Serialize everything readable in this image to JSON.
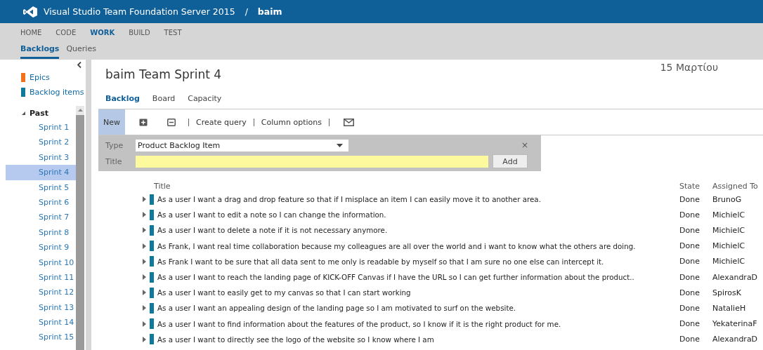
{
  "header": {
    "product": "Visual Studio Team Foundation Server 2015",
    "separator": "/",
    "project": "baim"
  },
  "nav": [
    {
      "label": "HOME",
      "selected": false
    },
    {
      "label": "CODE",
      "selected": false
    },
    {
      "label": "WORK",
      "selected": true
    },
    {
      "label": "BUILD",
      "selected": false
    },
    {
      "label": "TEST",
      "selected": false
    }
  ],
  "subnav": [
    {
      "label": "Backlogs",
      "selected": true
    },
    {
      "label": "Queries",
      "selected": false
    }
  ],
  "sidebar": {
    "levels": [
      {
        "label": "Epics",
        "color": "#f2711c"
      },
      {
        "label": "Backlog items",
        "color": "#0e7a9a"
      }
    ],
    "tree": {
      "label": "Past",
      "expanded": true,
      "children": [
        {
          "label": "Sprint 1",
          "selected": false
        },
        {
          "label": "Sprint 2",
          "selected": false
        },
        {
          "label": "Sprint 3",
          "selected": false
        },
        {
          "label": "Sprint 4",
          "selected": true
        },
        {
          "label": "Sprint 5",
          "selected": false
        },
        {
          "label": "Sprint 6",
          "selected": false
        },
        {
          "label": "Sprint 7",
          "selected": false
        },
        {
          "label": "Sprint 8",
          "selected": false
        },
        {
          "label": "Sprint 9",
          "selected": false
        },
        {
          "label": "Sprint 10",
          "selected": false
        },
        {
          "label": "Sprint 11",
          "selected": false
        },
        {
          "label": "Sprint 12",
          "selected": false
        },
        {
          "label": "Sprint 13",
          "selected": false
        },
        {
          "label": "Sprint 14",
          "selected": false
        },
        {
          "label": "Sprint 15",
          "selected": false
        }
      ]
    }
  },
  "page_title": "baim Team Sprint 4",
  "date": "15 Μαρτίου",
  "view_tabs": [
    {
      "label": "Backlog",
      "selected": true
    },
    {
      "label": "Board",
      "selected": false
    },
    {
      "label": "Capacity",
      "selected": false
    }
  ],
  "toolbar": {
    "new_label": "New",
    "new_selected": true,
    "links": [
      "Create query",
      "Column options"
    ]
  },
  "add_form": {
    "type_label": "Type",
    "type_value": "Product Backlog Item",
    "title_label": "Title",
    "add_label": "Add",
    "close": "×"
  },
  "table": {
    "columns": [
      "Title",
      "State",
      "Assigned To"
    ],
    "rows": [
      {
        "title": "As a user I want a drag and drop feature so that if I misplace an item I can easily move it to another area.",
        "state": "Done",
        "assigned_to": "BrunoG"
      },
      {
        "title": "As a user I want to edit a note so I can change the information.",
        "state": "Done",
        "assigned_to": "MichielC"
      },
      {
        "title": "As a user I want to delete a note if it is not necessary anymore.",
        "state": "Done",
        "assigned_to": "MichielC"
      },
      {
        "title": "As Frank, I want real time collaboration because my colleagues are all over the world and i want to know what the others are doing.",
        "state": "Done",
        "assigned_to": "MichielC"
      },
      {
        "title": "As Frank I want to be sure that all data sent to me only is readable by myself so that I am sure no one else can intercept it.",
        "state": "Done",
        "assigned_to": "MichielC"
      },
      {
        "title": "As a user I want to reach the landing page of KICK-OFF Canvas if I have the URL so I can get further information about the product..",
        "state": "Done",
        "assigned_to": "AlexandraD"
      },
      {
        "title": "As a user I want to easily get to my canvas so that I can start working",
        "state": "Done",
        "assigned_to": "SpirosK"
      },
      {
        "title": "As a user I want an appealing design of the landing page so I am motivated to surf on the website.",
        "state": "Done",
        "assigned_to": "NatalieH"
      },
      {
        "title": "As a user I want to find information about the features of the product, so I know if it is the right product for me.",
        "state": "Done",
        "assigned_to": "YekaterinaF"
      },
      {
        "title": "As a user I want to directly see the logo of the website so I know where I am",
        "state": "Done",
        "assigned_to": "AlexandraD"
      }
    ]
  }
}
